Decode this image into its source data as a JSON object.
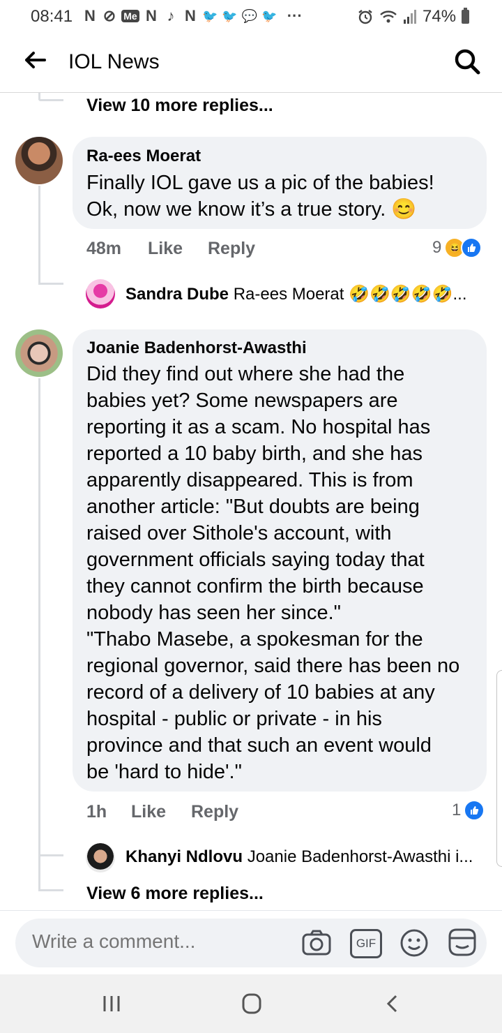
{
  "status_bar": {
    "time": "08:41",
    "notification_icons": [
      "N",
      "⊘",
      "Me",
      "N",
      "♪",
      "N",
      "🐦",
      "🐦",
      "💬",
      "🐦"
    ],
    "more": "···",
    "battery": "74%",
    "icons": [
      "alarm-icon",
      "wifi-icon",
      "signal-icon",
      "battery-icon"
    ]
  },
  "header": {
    "title": "IOL News",
    "back_icon": "back-arrow-icon",
    "search_icon": "search-icon"
  },
  "thread": {
    "view_more_top": "View 10 more replies...",
    "comments": [
      {
        "author": "Ra-ees Moerat",
        "text": "Finally IOL gave us a pic of the babies!\nOk, now we know it’s a true story. 😊",
        "time": "48m",
        "like_label": "Like",
        "reply_label": "Reply",
        "reaction_count": "9",
        "reactions": [
          "haha",
          "like"
        ],
        "reply_preview": {
          "author": "Sandra Dube",
          "text": "Ra-ees Moerat 🤣🤣🤣🤣🤣..."
        }
      },
      {
        "author": "Joanie Badenhorst-Awasthi",
        "text": "Did they find out where she had the\nbabies yet? Some newspapers are\nreporting it as a scam. No hospital has\nreported a 10 baby birth, and she has\napparently disappeared. This is from\nanother article: \"But doubts are being\nraised over Sithole's account, with\ngovernment officials saying today that\nthey cannot confirm the birth because\nnobody has seen her since.\"\n\"Thabo Masebe, a spokesman for the\nregional governor, said there has been no\nrecord of a delivery of 10 babies at any\nhospital - public or private - in his\nprovince and that such an event would\nbe 'hard to hide'.\"",
        "time": "1h",
        "like_label": "Like",
        "reply_label": "Reply",
        "reaction_count": "1",
        "reactions": [
          "like"
        ],
        "reply_preview": {
          "author": "Khanyi Ndlovu",
          "text": "Joanie Badenhorst-Awasthi i..."
        },
        "view_more": "View 6 more replies..."
      }
    ]
  },
  "composer": {
    "placeholder": "Write a comment...",
    "icons": [
      "camera-icon",
      "gif-icon",
      "emoji-icon",
      "sticker-icon"
    ],
    "gif_label": "GIF"
  },
  "navbar": {
    "buttons": [
      "recent-apps-icon",
      "home-icon",
      "back-icon"
    ]
  },
  "colors": {
    "like_blue": "#1877f2",
    "bubble_bg": "#f0f2f5",
    "meta_gray": "#65676b"
  }
}
